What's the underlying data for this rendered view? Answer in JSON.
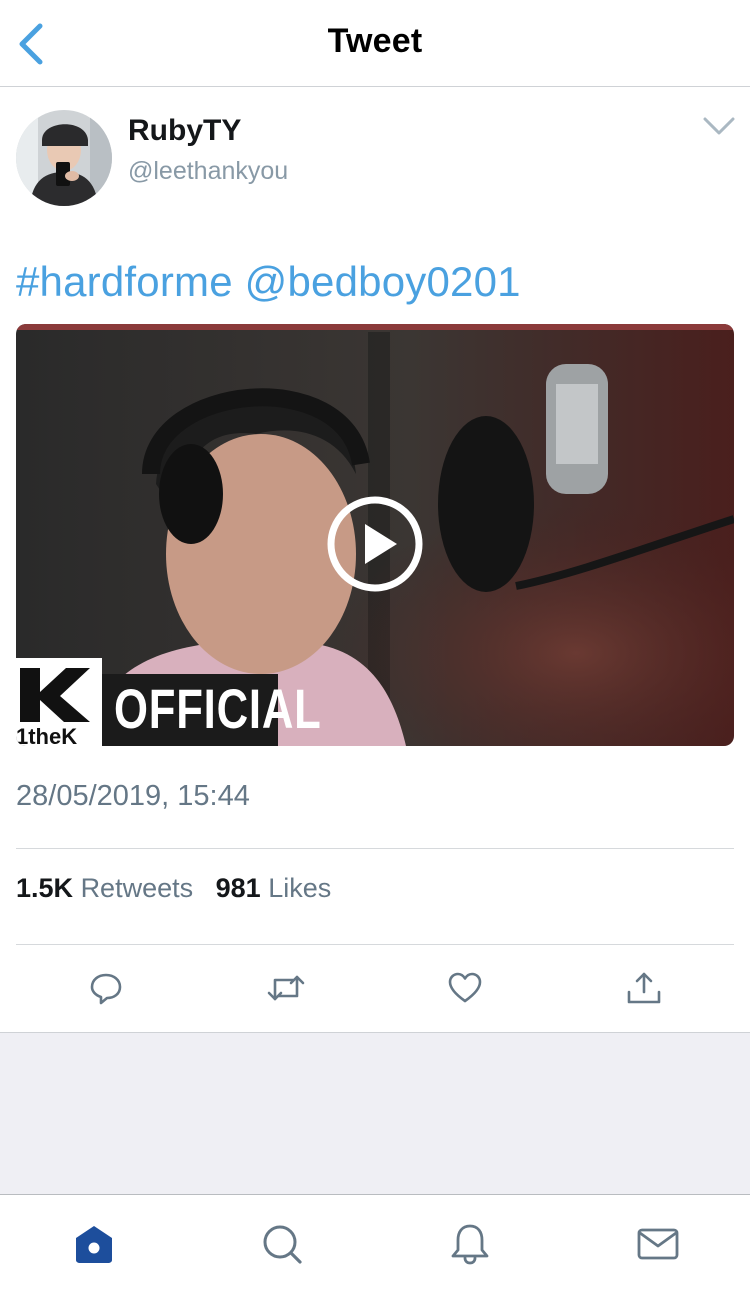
{
  "navbar": {
    "title": "Tweet",
    "back_icon": "chevron-left-icon"
  },
  "author": {
    "display_name": "RubyTY",
    "username": "@leethankyou"
  },
  "tweet": {
    "hashtag": "#hardforme",
    "mention": "@bedboy0201",
    "timestamp": "28/05/2019, 15:44"
  },
  "video": {
    "watermark_label": "OFFICIAL",
    "channel_label": "1theK"
  },
  "stats": {
    "retweets_count": "1.5K",
    "retweets_label": "Retweets",
    "likes_count": "981",
    "likes_label": "Likes"
  },
  "actions": [
    "reply-icon",
    "retweet-icon",
    "heart-icon",
    "share-icon"
  ],
  "tabbar": [
    "home-icon",
    "search-icon",
    "bell-icon",
    "mail-icon"
  ],
  "colors": {
    "accent": "#4aa1e0",
    "tab_active": "#1d4e9c",
    "icon_gray": "#657786",
    "secondary_text": "#657786"
  }
}
